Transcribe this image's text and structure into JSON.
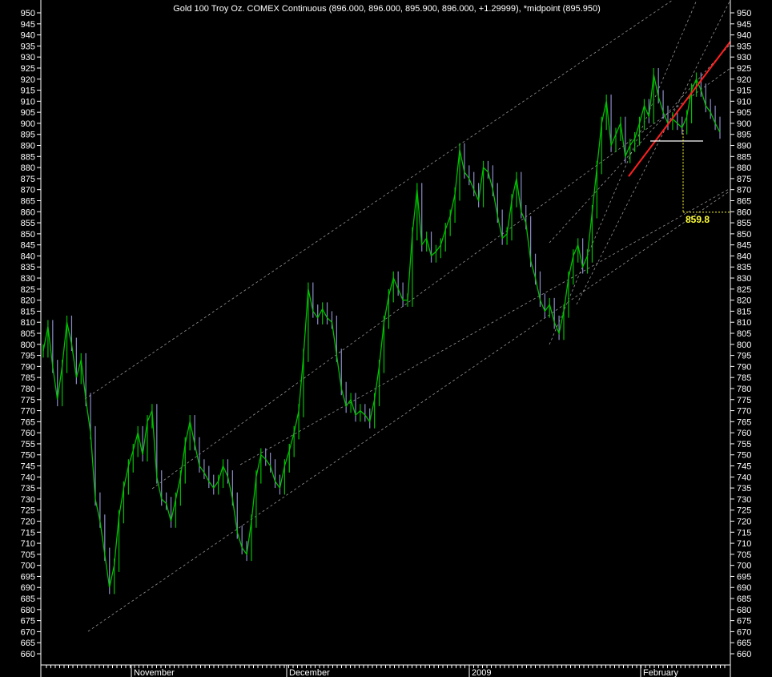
{
  "chart_data": {
    "type": "line",
    "title": "Gold 100 Troy Oz. COMEX Continuous (896.000, 896.000, 895.900, 896.000, +1.29999), *midpoint (895.950)",
    "xlabel": "",
    "ylabel": "",
    "ylim": [
      658,
      952
    ],
    "y_ticks": [
      950,
      945,
      940,
      935,
      930,
      925,
      920,
      915,
      910,
      905,
      900,
      895,
      890,
      885,
      880,
      875,
      870,
      865,
      860,
      855,
      850,
      845,
      840,
      835,
      830,
      825,
      820,
      815,
      810,
      805,
      800,
      795,
      790,
      785,
      780,
      775,
      770,
      765,
      760,
      755,
      750,
      745,
      740,
      735,
      730,
      725,
      720,
      715,
      710,
      705,
      700,
      695,
      690,
      685,
      680,
      675,
      670,
      665,
      660
    ],
    "month_labels": [
      "November",
      "December",
      "2009",
      "February"
    ],
    "grid": false,
    "series": [
      {
        "color": "#00c000",
        "values": [
          797,
          808,
          790,
          775,
          790,
          810,
          800,
          785,
          793,
          775,
          760,
          730,
          720,
          705,
          690,
          700,
          722,
          735,
          745,
          752,
          760,
          750,
          765,
          770,
          740,
          730,
          728,
          720,
          730,
          740,
          755,
          765,
          755,
          745,
          742,
          738,
          735,
          738,
          745,
          740,
          730,
          715,
          708,
          705,
          720,
          740,
          750,
          748,
          745,
          738,
          735,
          745,
          752,
          760,
          770,
          795,
          825,
          815,
          812,
          816,
          812,
          810,
          795,
          780,
          772,
          775,
          768,
          770,
          768,
          765,
          775,
          790,
          810,
          822,
          830,
          825,
          820,
          820,
          850,
          870,
          845,
          848,
          840,
          842,
          845,
          852,
          858,
          868,
          888,
          878,
          875,
          870,
          865,
          880,
          878,
          870,
          858,
          848,
          850,
          865,
          875,
          860,
          855,
          838,
          830,
          820,
          815,
          818,
          810,
          805,
          815,
          830,
          840,
          845,
          835,
          840,
          860,
          880,
          900,
          910,
          890,
          895,
          900,
          885,
          890,
          893,
          900,
          908,
          903,
          922,
          912,
          905,
          900,
          902,
          900,
          898,
          903,
          915,
          920,
          915,
          908,
          905,
          900,
          896
        ]
      }
    ],
    "overlays": {
      "red_trendline": [
        [
          876,
          876
        ],
        [
          937,
          937
        ]
      ],
      "support_level": 892,
      "target_level": 859.8,
      "target_label": "859.8"
    }
  },
  "colors": {
    "price": "#00c000",
    "price_down": "#8c8cc8",
    "channel": "#c8c8c8",
    "trendline": "#ff2020",
    "support": "#ffffff",
    "target": "#ffff33"
  }
}
